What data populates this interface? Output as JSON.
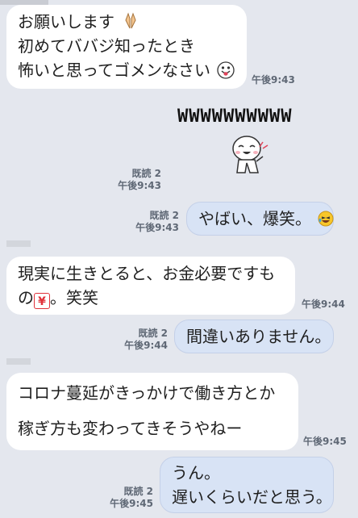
{
  "messages": [
    {
      "id": "m1",
      "dir": "in",
      "lines": [
        "お願いします",
        "初めてババジ知ったとき",
        "怖いと思ってゴメンなさい"
      ],
      "time": "午後9:43"
    },
    {
      "id": "m2",
      "dir": "out",
      "kind": "stamp",
      "text": "WWWWWWWWWW",
      "read": "既読 2",
      "time": "午後9:43"
    },
    {
      "id": "m3",
      "dir": "out",
      "text": "やばい、爆笑。",
      "read": "既読 2",
      "time": "午後9:43"
    },
    {
      "id": "m4",
      "dir": "in",
      "lines": [
        "現実に生きとると、お金必要ですも",
        "の",
        "。笑笑"
      ],
      "time": "午後9:44"
    },
    {
      "id": "m5",
      "dir": "out",
      "text": "間違いありません。",
      "read": "既読 2",
      "time": "午後9:44"
    },
    {
      "id": "m6",
      "dir": "in",
      "lines": [
        "コロナ蔓延がきっかけで働き方とか",
        "稼ぎ方も変わってきそうやねー"
      ],
      "time": "午後9:45"
    },
    {
      "id": "m7",
      "dir": "out",
      "lines": [
        "うん。",
        "遅いくらいだと思う。"
      ],
      "read": "既読 2",
      "time": "午後9:45"
    }
  ],
  "icons": {
    "pray": "pray-emoji",
    "tongue": "tongue-face-emoji",
    "laugh": "laughing-tears-emoji",
    "yen": "yen-emoji",
    "sticker": "laughing-character-sticker"
  },
  "colors": {
    "background": "#e4e7ee",
    "incoming_bubble": "#ffffff",
    "outgoing_bubble": "#d8e3f5",
    "meta_text": "#5f6875"
  }
}
